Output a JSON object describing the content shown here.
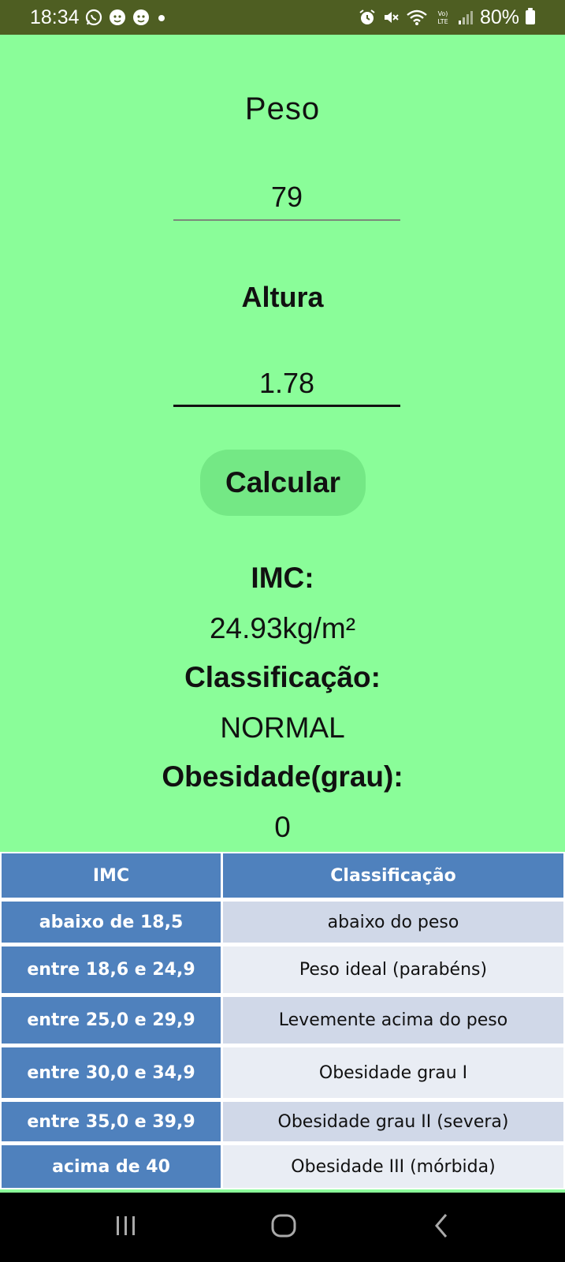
{
  "status_bar": {
    "time": "18:34",
    "battery": "80%",
    "icons_left": [
      "whatsapp-icon",
      "notification-face-icon",
      "notification-face-icon",
      "dot-icon"
    ],
    "icons_right": [
      "alarm-icon",
      "mute-icon",
      "wifi-icon",
      "volte-icon",
      "signal-icon",
      "battery-icon"
    ],
    "background": "#4e5e22"
  },
  "form": {
    "peso_label": "Peso",
    "peso_value": "79",
    "altura_label": "Altura",
    "altura_value": "1.78",
    "calcular_label": "Calcular"
  },
  "result": {
    "imc_label": "IMC:",
    "imc_value": "24.93kg/m²",
    "classificacao_label": "Classificação:",
    "classificacao_value": "NORMAL",
    "obesidade_label": "Obesidade(grau):",
    "obesidade_value": "0"
  },
  "table": {
    "headers": [
      "IMC",
      "Classificação"
    ],
    "rows": [
      [
        "abaixo de 18,5",
        "abaixo do peso"
      ],
      [
        "entre 18,6 e 24,9",
        "Peso ideal (parabéns)"
      ],
      [
        "entre 25,0 e 29,9",
        "Levemente acima do peso"
      ],
      [
        "entre 30,0 e 34,9",
        "Obesidade grau I"
      ],
      [
        "entre 35,0 e 39,9",
        "Obesidade grau II (severa)"
      ],
      [
        "acima de 40",
        "Obesidade III (mórbida)"
      ]
    ]
  },
  "nav_bar": {
    "buttons": [
      "recent-apps-icon",
      "home-icon",
      "back-icon"
    ]
  },
  "colors": {
    "background": "#8afd99",
    "button": "#74e885",
    "table_header": "#4f81bd",
    "table_alt": "#d0d8e8",
    "table_light": "#e9edf4"
  }
}
